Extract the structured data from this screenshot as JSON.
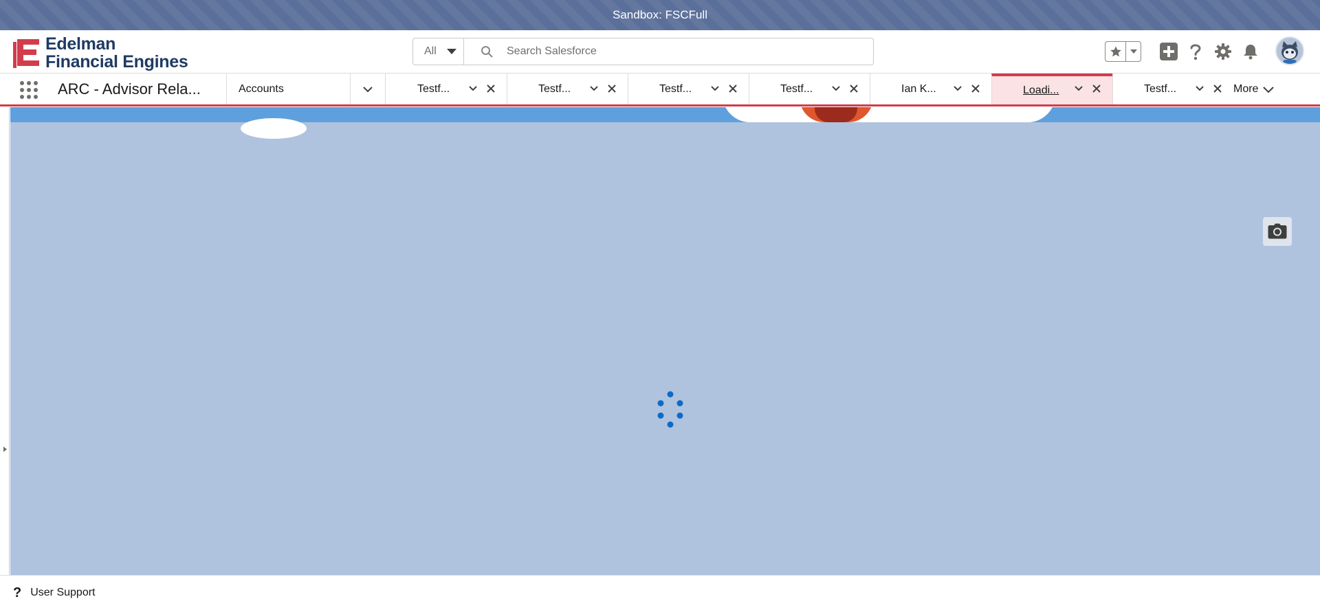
{
  "sandbox_banner": {
    "text": "Sandbox: FSCFull",
    "background": "#5a6f99"
  },
  "brand": {
    "logo_line1": "Edelman",
    "logo_line2": "Financial Engines",
    "logo_color": "#1f3a63",
    "logo_mark_color": "#d33c4b"
  },
  "search": {
    "scope": "All",
    "placeholder": "Search Salesforce",
    "value": ""
  },
  "header_icons": [
    "favorites-star-icon",
    "favorites-list-icon",
    "global-actions-plus-icon",
    "help-icon",
    "setup-gear-icon",
    "notifications-bell-icon",
    "user-avatar"
  ],
  "nav": {
    "app_name": "ARC - Advisor Rela...",
    "accounts_tab": "Accounts",
    "workspace_tabs": [
      {
        "label": "Testf...",
        "active": false
      },
      {
        "label": "Testf...",
        "active": false
      },
      {
        "label": "Testf...",
        "active": false
      },
      {
        "label": "Testf...",
        "active": false
      },
      {
        "label": "Ian K...",
        "active": false
      },
      {
        "label": "Loadi...",
        "active": true
      },
      {
        "label": "Testf...",
        "active": false
      }
    ],
    "more_label": "More",
    "accent_color": "#d33c4b"
  },
  "workspace": {
    "status": "loading",
    "background": "#b0c3de",
    "spinner_color": "#0b6bcb"
  },
  "utility_bar": {
    "items": [
      {
        "icon": "question-icon",
        "label": "User Support"
      }
    ]
  }
}
